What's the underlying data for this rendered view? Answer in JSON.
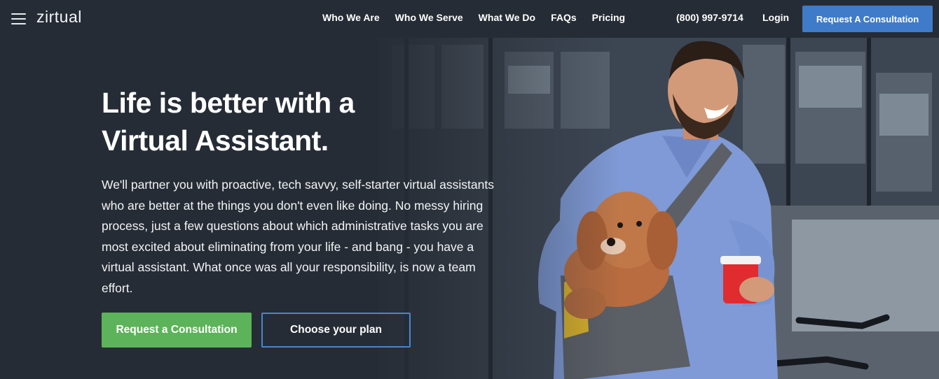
{
  "brand": {
    "logo_text": "zirtual"
  },
  "nav": {
    "menu_icon": "hamburger-menu-icon",
    "links": [
      {
        "label": "Who We Are"
      },
      {
        "label": "Who We Serve"
      },
      {
        "label": "What We Do"
      },
      {
        "label": "FAQs"
      },
      {
        "label": "Pricing"
      }
    ],
    "phone": "(800) 997-9714",
    "login": "Login",
    "cta": "Request A Consultation"
  },
  "hero": {
    "headline": "Life is better with a Virtual Assistant.",
    "body": "We'll partner you with proactive, tech savvy, self-starter virtual assistants who are better at the things you don't even like doing. No messy hiring process, just a few questions about which administrative tasks you are most excited about eliminating from your life - and bang - you have a virtual assistant. What once was all your responsibility, is now a team effort.",
    "primary_button": "Request a Consultation",
    "secondary_button": "Choose your plan"
  },
  "colors": {
    "background": "#262c35",
    "nav_cta": "#3f7bc8",
    "primary_button": "#5db35a",
    "secondary_border": "#4b84cf"
  }
}
